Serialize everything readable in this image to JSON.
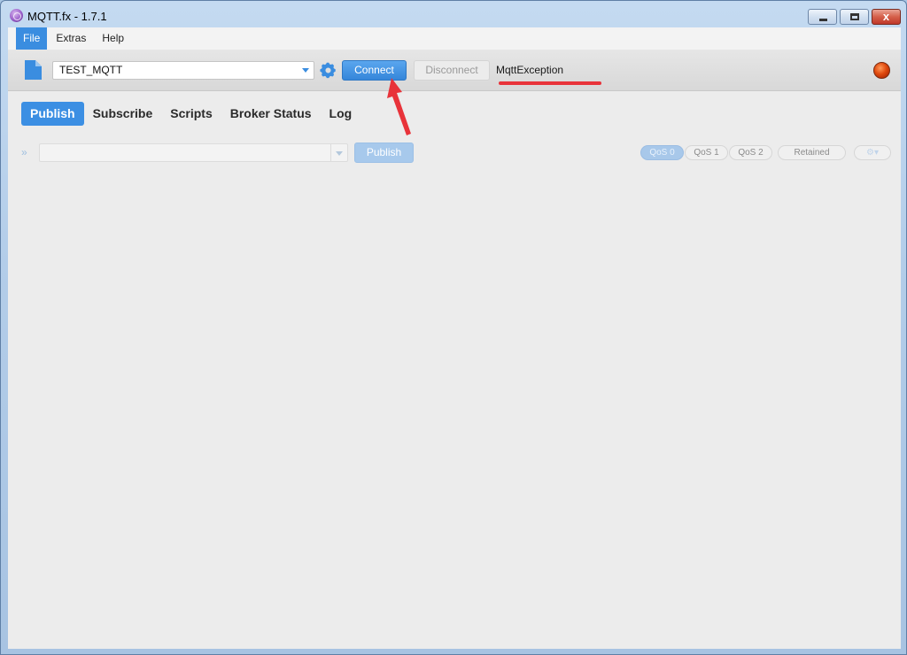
{
  "window": {
    "title": "MQTT.fx - 1.7.1",
    "app_icon": "mqttfx-app-icon",
    "controls": {
      "minimize": "minimize-icon",
      "maximize": "maximize-icon",
      "close": "close-icon",
      "close_glyph": "x"
    }
  },
  "menu": {
    "items": [
      {
        "label": "File",
        "active": true
      },
      {
        "label": "Extras",
        "active": false
      },
      {
        "label": "Help",
        "active": false
      }
    ]
  },
  "toolbar": {
    "profile": "TEST_MQTT",
    "connect_label": "Connect",
    "disconnect_label": "Disconnect",
    "status_text": "MqttException",
    "status_color": "#e04a0e",
    "accent_color": "#3a8de0"
  },
  "tabs": [
    {
      "label": "Publish",
      "active": true
    },
    {
      "label": "Subscribe",
      "active": false
    },
    {
      "label": "Scripts",
      "active": false
    },
    {
      "label": "Broker Status",
      "active": false
    },
    {
      "label": "Log",
      "active": false
    }
  ],
  "publish": {
    "topic_value": "",
    "publish_label": "Publish",
    "qos": [
      {
        "label": "QoS 0",
        "selected": true
      },
      {
        "label": "QoS 1",
        "selected": false
      },
      {
        "label": "QoS 2",
        "selected": false
      }
    ],
    "retained_label": "Retained",
    "options_label": "⚙"
  },
  "annotation": {
    "color": "#e8333a"
  }
}
